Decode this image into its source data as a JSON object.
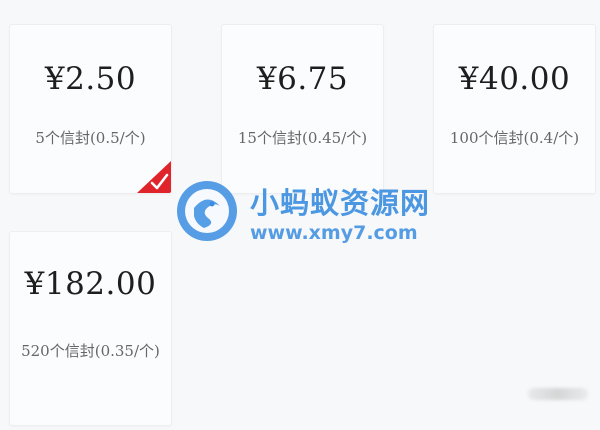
{
  "options": [
    {
      "price": "¥2.50",
      "desc": "5个信封(0.5/个)",
      "selected": true
    },
    {
      "price": "¥6.75",
      "desc": "15个信封(0.45/个)",
      "selected": false
    },
    {
      "price": "¥40.00",
      "desc": "100个信封(0.4/个)",
      "selected": false
    },
    {
      "price": "¥182.00",
      "desc": "520个信封(0.35/个)",
      "selected": false
    }
  ],
  "watermark": {
    "title": "小蚂蚁资源网",
    "url": "www.xmy7.com"
  },
  "colors": {
    "selected_badge": "#e0242b",
    "watermark": "#3a8de0"
  },
  "icons": {
    "selected": "checkmark-icon",
    "watermark_logo": "ant-logo-icon"
  }
}
